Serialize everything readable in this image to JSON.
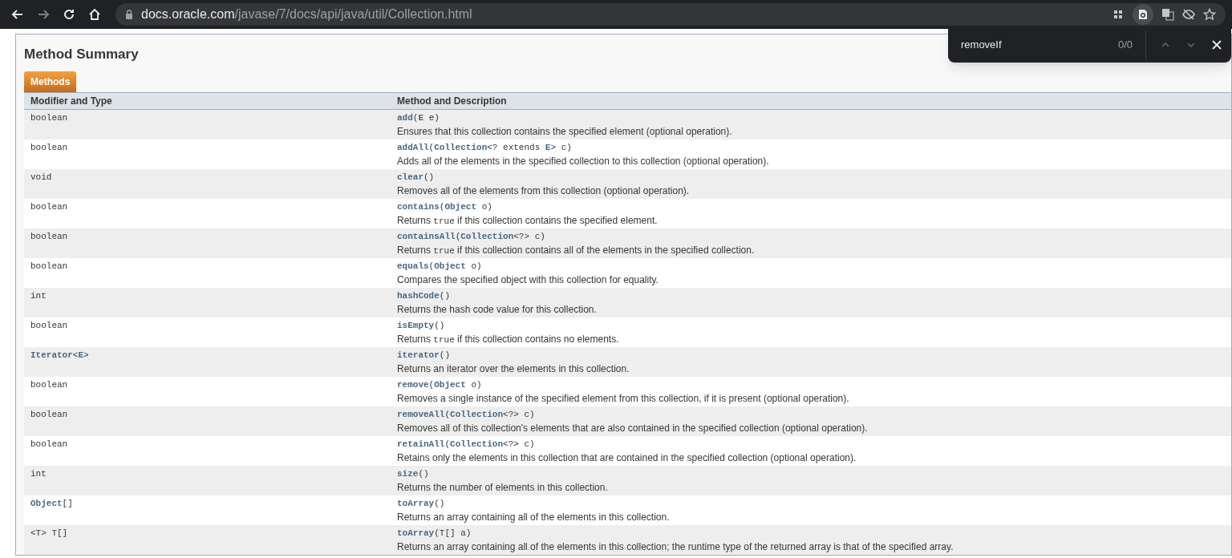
{
  "browser": {
    "url_host": "docs.oracle.com",
    "url_path": "/javase/7/docs/api/java/util/Collection.html"
  },
  "find_bar": {
    "value": "removeIf",
    "count": "0/0"
  },
  "title": "Method Summary",
  "tabs": [
    {
      "label": "Methods",
      "selected": true
    }
  ],
  "table": {
    "columns": [
      "Modifier and Type",
      "Method and Description"
    ],
    "rows": [
      {
        "type": "boolean",
        "signature": "**add**(**E** e)",
        "description": [
          {
            "kind": "text",
            "text": "Ensures that this collection contains the specified element (optional operation)."
          }
        ]
      },
      {
        "type": "boolean",
        "signature": "**addAll**(**Collection**<? extends **E**> c)",
        "description": [
          {
            "kind": "text",
            "text": "Adds all of the elements in the specified collection to this collection (optional operation)."
          }
        ]
      },
      {
        "type": "void",
        "signature": "**clear**()",
        "description": [
          {
            "kind": "text",
            "text": "Removes all of the elements from this collection (optional operation)."
          }
        ]
      },
      {
        "type": "boolean",
        "signature": "**contains**(**Object** o)",
        "description": [
          {
            "kind": "text",
            "text": "Returns "
          },
          {
            "kind": "code",
            "text": "true"
          },
          {
            "kind": "text",
            "text": " if this collection contains the specified element."
          }
        ]
      },
      {
        "type": "boolean",
        "signature": "**containsAll**(**Collection**<?> c)",
        "description": [
          {
            "kind": "text",
            "text": "Returns "
          },
          {
            "kind": "code",
            "text": "true"
          },
          {
            "kind": "text",
            "text": " if this collection contains all of the elements in the specified collection."
          }
        ]
      },
      {
        "type": "boolean",
        "signature": "**equals**(**Object** o)",
        "description": [
          {
            "kind": "text",
            "text": "Compares the specified object with this collection for equality."
          }
        ]
      },
      {
        "type": "int",
        "signature": "**hashCode**()",
        "description": [
          {
            "kind": "text",
            "text": "Returns the hash code value for this collection."
          }
        ]
      },
      {
        "type": "boolean",
        "signature": "**isEmpty**()",
        "description": [
          {
            "kind": "text",
            "text": "Returns "
          },
          {
            "kind": "code",
            "text": "true"
          },
          {
            "kind": "text",
            "text": " if this collection contains no elements."
          }
        ]
      },
      {
        "type": "**Iterator**<**E**>",
        "signature": "**iterator**()",
        "description": [
          {
            "kind": "text",
            "text": "Returns an iterator over the elements in this collection."
          }
        ]
      },
      {
        "type": "boolean",
        "signature": "**remove**(**Object** o)",
        "description": [
          {
            "kind": "text",
            "text": "Removes a single instance of the specified element from this collection, if it is present (optional operation)."
          }
        ]
      },
      {
        "type": "boolean",
        "signature": "**removeAll**(**Collection**<?> c)",
        "description": [
          {
            "kind": "text",
            "text": "Removes all of this collection's elements that are also contained in the specified collection (optional operation)."
          }
        ]
      },
      {
        "type": "boolean",
        "signature": "**retainAll**(**Collection**<?> c)",
        "description": [
          {
            "kind": "text",
            "text": "Retains only the elements in this collection that are contained in the specified collection (optional operation)."
          }
        ]
      },
      {
        "type": "int",
        "signature": "**size**()",
        "description": [
          {
            "kind": "text",
            "text": "Returns the number of elements in this collection."
          }
        ]
      },
      {
        "type": "**Object**[]",
        "signature": "**toArray**()",
        "description": [
          {
            "kind": "text",
            "text": "Returns an array containing all of the elements in this collection."
          }
        ]
      },
      {
        "type": "<T> T[]",
        "signature": "**toArray**(T[] a)",
        "description": [
          {
            "kind": "text",
            "text": "Returns an array containing all of the elements in this collection; the runtime type of the returned array is that of the specified array."
          }
        ]
      }
    ]
  }
}
